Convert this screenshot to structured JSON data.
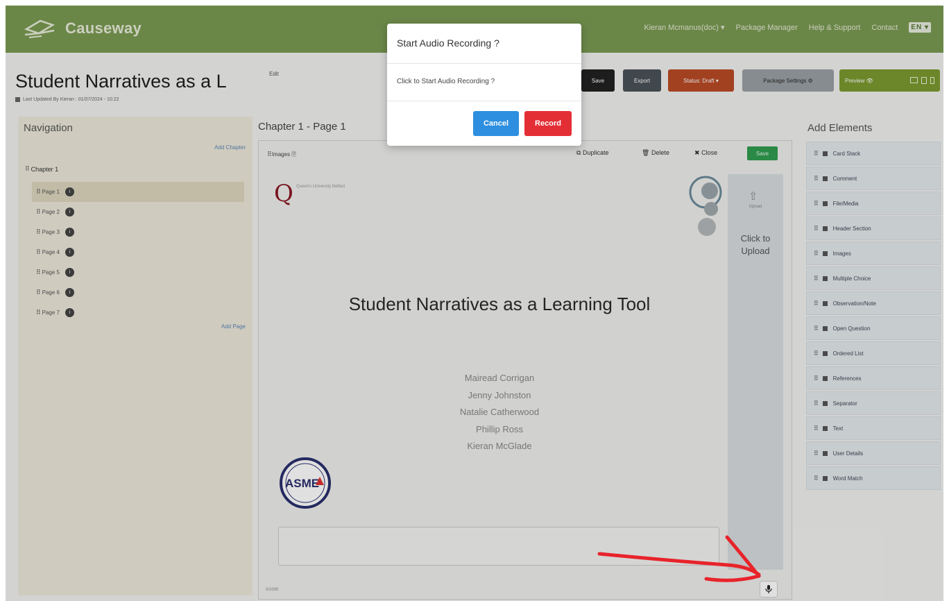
{
  "brand": {
    "name": "Causeway"
  },
  "topnav": {
    "user": "Kieran Mcmanus(doc) ▾",
    "links": [
      "Package Manager",
      "Help & Support",
      "Contact"
    ],
    "lang": "EN ▾"
  },
  "header": {
    "title": "Student Narratives as a L",
    "edit_label": "Edit",
    "last_updated": "Last Updated By Kieran : 01/07/2024 - 10:22"
  },
  "toolbar": {
    "save": "Save",
    "export": "Export",
    "status": "Status: Draft ▾",
    "settings": "Package Settings ⚙",
    "preview": "Preview 👁"
  },
  "navigation": {
    "title": "Navigation",
    "add_chapter": "Add Chapter",
    "chapter": "Chapter 1",
    "pages": [
      {
        "label": "Page 1",
        "badge": "i"
      },
      {
        "label": "Page 2",
        "badge": "i"
      },
      {
        "label": "Page 3",
        "badge": "i"
      },
      {
        "label": "Page 4",
        "badge": "i"
      },
      {
        "label": "Page 5",
        "badge": "i"
      },
      {
        "label": "Page 6",
        "badge": "i"
      },
      {
        "label": "Page 7",
        "badge": "i"
      }
    ],
    "add_page": "Add Page"
  },
  "editor": {
    "heading": "Chapter 1 - Page 1",
    "images_label": "Images",
    "duplicate": "Duplicate",
    "delete": "Delete",
    "close": "Close",
    "save": "Save",
    "slide": {
      "logo_text": "Queen's University Belfast",
      "title": "Student Narratives as a Learning Tool",
      "authors": [
        "Mairead Corrigan",
        "Jenny Johnston",
        "Natalie Catherwood",
        "Phillip Ross",
        "Kieran McGlade"
      ],
      "asme": "ASME"
    },
    "upload": {
      "small": "Upload",
      "label": "Click to Upload"
    },
    "char_count": "0/1000"
  },
  "add_elements": {
    "title": "Add Elements",
    "items": [
      "Card Stack",
      "Comment",
      "File/Media",
      "Header Section",
      "Images",
      "Multiple Choice",
      "Observation/Note",
      "Open Question",
      "Ordered List",
      "References",
      "Separator",
      "Text",
      "User Details",
      "Word Match"
    ]
  },
  "modal": {
    "title": "Start Audio Recording ?",
    "body": "Click to Start Audio Recording ?",
    "cancel": "Cancel",
    "record": "Record"
  },
  "colors": {
    "nav_green": "#7a9a52",
    "cancel_blue": "#2e8fe0",
    "record_red": "#e42e36",
    "annotation_arrow": "#e8232a"
  }
}
